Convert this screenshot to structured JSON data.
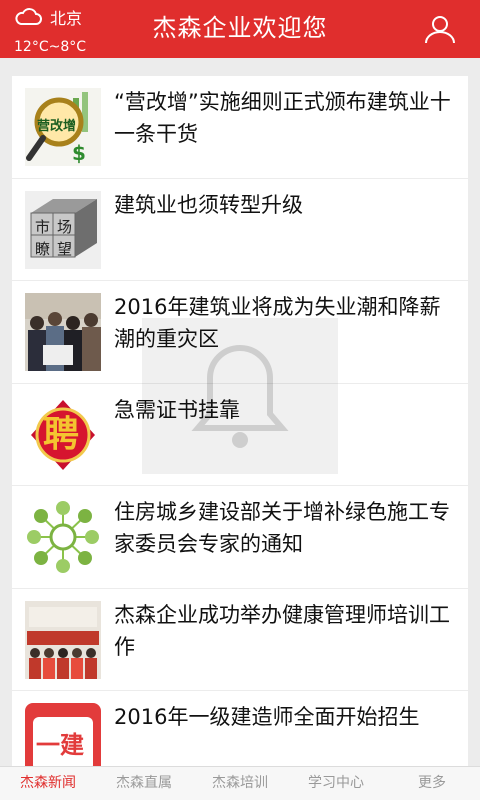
{
  "header": {
    "city": "北京",
    "temperature": "12°C~8°C",
    "title": "杰森企业欢迎您",
    "weather_icon": "cloud-icon",
    "user_icon": "user-icon"
  },
  "news": [
    {
      "title": "“营改增”实施细则正式颁布建筑业十一条干货",
      "thumb_text": "营改增"
    },
    {
      "title": "建筑业也须转型升级",
      "thumb_text_1": "市",
      "thumb_text_2": "场",
      "thumb_text_3": "瞭",
      "thumb_text_4": "望"
    },
    {
      "title": "2016年建筑业将成为失业潮和降薪潮的重灾区"
    },
    {
      "title": "急需证书挂靠",
      "thumb_text": "聘"
    },
    {
      "title": "住房城乡建设部关于增补绿色施工专家委员会专家的通知"
    },
    {
      "title": "杰森企业成功举办健康管理师培训工作"
    },
    {
      "title": "2016年一级建造师全面开始招生",
      "thumb_text": "一建"
    }
  ],
  "tabs": [
    {
      "label": "杰森新闻",
      "active": true
    },
    {
      "label": "杰森直属"
    },
    {
      "label": "杰森培训"
    },
    {
      "label": "学习中心"
    },
    {
      "label": "更多"
    }
  ],
  "colors": {
    "brand": "#e02e2d",
    "tab_inactive": "#9a9a9a"
  }
}
